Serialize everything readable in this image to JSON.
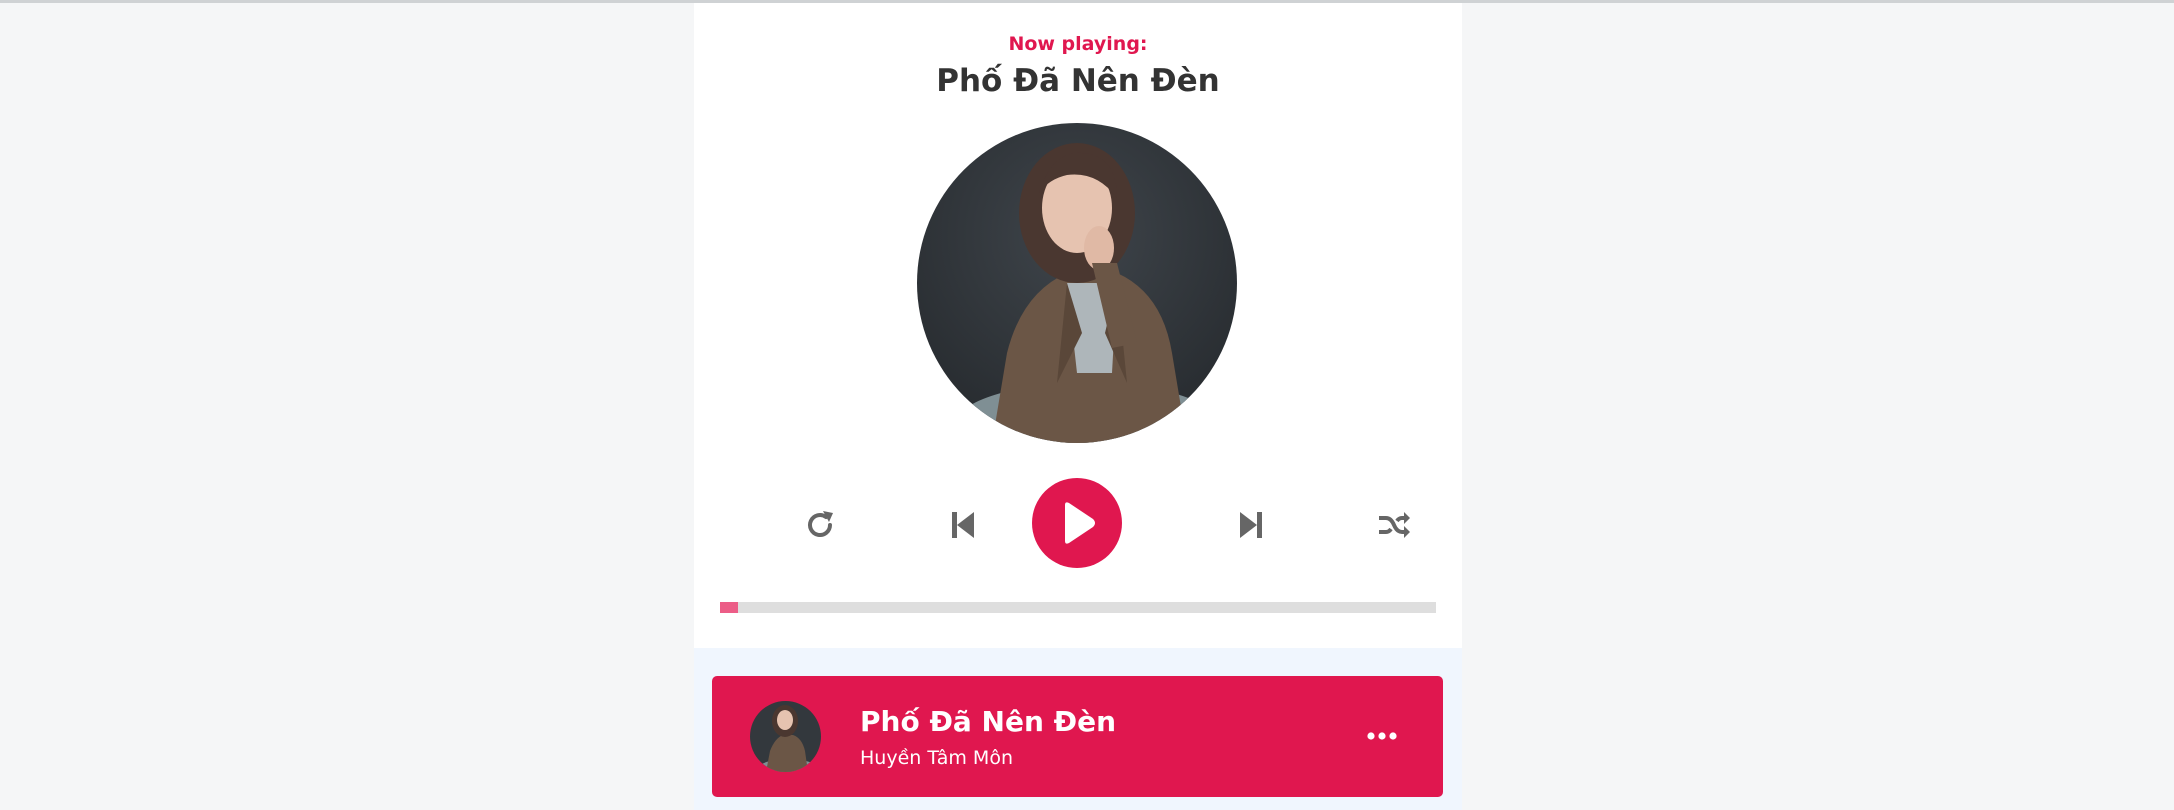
{
  "header": {
    "now_playing_label": "Now playing:",
    "song_title": "Phố Đã Nên Đèn"
  },
  "controls": {
    "repeat_icon": "repeat-icon",
    "prev_icon": "step-backward-icon",
    "play_icon": "play-icon",
    "next_icon": "step-forward-icon",
    "random_icon": "shuffle-icon"
  },
  "progress": {
    "value_percent": 2.5
  },
  "playlist": {
    "items": [
      {
        "title": "Phố Đã Nên Đèn",
        "author": "Huyền Tâm Môn",
        "active": true,
        "option_icon": "ellipsis-icon"
      }
    ]
  },
  "colors": {
    "accent": "#e0174f",
    "progress_fill": "#ec5d87",
    "progress_track": "#dedede",
    "icon": "#666666",
    "title_text": "#333333",
    "background": "#f5f6f7",
    "playlist_bg": "#f0f6fe"
  }
}
